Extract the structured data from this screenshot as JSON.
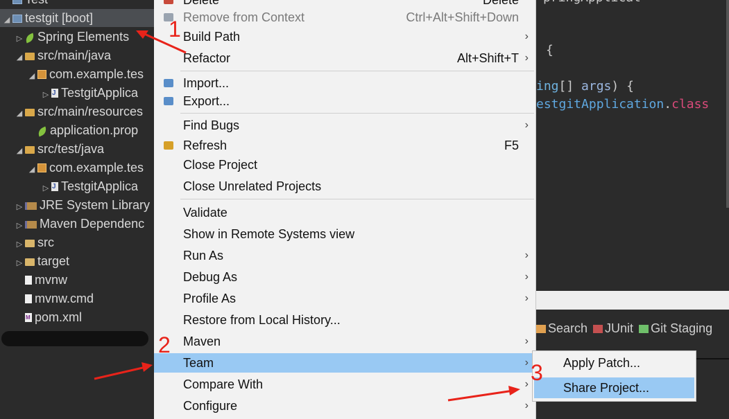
{
  "tree": {
    "items": [
      {
        "label": "Test",
        "icon": "project-icon",
        "twisty": "",
        "selected": false,
        "indent": 0
      },
      {
        "label": "testgit [boot]",
        "icon": "project-icon",
        "twisty": "◢",
        "selected": true,
        "indent": 0
      },
      {
        "label": "Spring Elements",
        "icon": "spring-leaf-icon",
        "twisty": "▷",
        "selected": false,
        "indent": 1
      },
      {
        "label": "src/main/java",
        "icon": "source-folder-icon",
        "twisty": "◢",
        "selected": false,
        "indent": 1
      },
      {
        "label": "com.example.tes",
        "icon": "package-icon",
        "twisty": "◢",
        "selected": false,
        "indent": 2
      },
      {
        "label": "TestgitApplica",
        "icon": "java-file-icon",
        "twisty": "▷",
        "selected": false,
        "indent": 3
      },
      {
        "label": "src/main/resources",
        "icon": "source-folder-icon",
        "twisty": "◢",
        "selected": false,
        "indent": 1
      },
      {
        "label": "application.prop",
        "icon": "spring-leaf-icon",
        "twisty": "",
        "selected": false,
        "indent": 2
      },
      {
        "label": "src/test/java",
        "icon": "source-folder-icon",
        "twisty": "◢",
        "selected": false,
        "indent": 1
      },
      {
        "label": "com.example.tes",
        "icon": "package-icon",
        "twisty": "◢",
        "selected": false,
        "indent": 2
      },
      {
        "label": "TestgitApplica",
        "icon": "java-file-icon",
        "twisty": "▷",
        "selected": false,
        "indent": 3
      },
      {
        "label": "JRE System Library",
        "icon": "library-icon",
        "twisty": "▷",
        "selected": false,
        "indent": 1
      },
      {
        "label": "Maven Dependenc",
        "icon": "library-icon",
        "twisty": "▷",
        "selected": false,
        "indent": 1
      },
      {
        "label": "src",
        "icon": "folder-icon",
        "twisty": "▷",
        "selected": false,
        "indent": 1
      },
      {
        "label": "target",
        "icon": "folder-icon",
        "twisty": "▷",
        "selected": false,
        "indent": 1
      },
      {
        "label": "mvnw",
        "icon": "file-icon",
        "twisty": "",
        "selected": false,
        "indent": 1
      },
      {
        "label": "mvnw.cmd",
        "icon": "file-icon",
        "twisty": "",
        "selected": false,
        "indent": 1
      },
      {
        "label": "pom.xml",
        "icon": "maven-file-icon",
        "twisty": "",
        "selected": false,
        "indent": 1
      }
    ]
  },
  "menu": {
    "items": [
      {
        "label": "Delete",
        "shortcut": "Delete",
        "submenu": false,
        "disabled": false,
        "icon": "delete-icon"
      },
      {
        "label": "Remove from Context",
        "shortcut": "Ctrl+Alt+Shift+Down",
        "submenu": false,
        "disabled": true,
        "icon": "remove-context-icon"
      },
      {
        "label": "Build Path",
        "shortcut": "",
        "submenu": true,
        "disabled": false,
        "icon": ""
      },
      {
        "label": "Refactor",
        "shortcut": "Alt+Shift+T",
        "submenu": true,
        "disabled": false,
        "icon": ""
      },
      {
        "label": "Import...",
        "shortcut": "",
        "submenu": false,
        "disabled": false,
        "icon": "import-icon"
      },
      {
        "label": "Export...",
        "shortcut": "",
        "submenu": false,
        "disabled": false,
        "icon": "export-icon"
      },
      {
        "label": "Find Bugs",
        "shortcut": "",
        "submenu": true,
        "disabled": false,
        "icon": ""
      },
      {
        "label": "Refresh",
        "shortcut": "F5",
        "submenu": false,
        "disabled": false,
        "icon": "refresh-icon"
      },
      {
        "label": "Close Project",
        "shortcut": "",
        "submenu": false,
        "disabled": false,
        "icon": ""
      },
      {
        "label": "Close Unrelated Projects",
        "shortcut": "",
        "submenu": false,
        "disabled": false,
        "icon": ""
      },
      {
        "label": "Validate",
        "shortcut": "",
        "submenu": false,
        "disabled": false,
        "icon": ""
      },
      {
        "label": "Show in Remote Systems view",
        "shortcut": "",
        "submenu": false,
        "disabled": false,
        "icon": ""
      },
      {
        "label": "Run As",
        "shortcut": "",
        "submenu": true,
        "disabled": false,
        "icon": ""
      },
      {
        "label": "Debug As",
        "shortcut": "",
        "submenu": true,
        "disabled": false,
        "icon": ""
      },
      {
        "label": "Profile As",
        "shortcut": "",
        "submenu": true,
        "disabled": false,
        "icon": ""
      },
      {
        "label": "Restore from Local History...",
        "shortcut": "",
        "submenu": false,
        "disabled": false,
        "icon": ""
      },
      {
        "label": "Maven",
        "shortcut": "",
        "submenu": true,
        "disabled": false,
        "icon": ""
      },
      {
        "label": "Team",
        "shortcut": "",
        "submenu": true,
        "disabled": false,
        "icon": "",
        "active": true
      },
      {
        "label": "Compare With",
        "shortcut": "",
        "submenu": true,
        "disabled": false,
        "icon": ""
      },
      {
        "label": "Configure",
        "shortcut": "",
        "submenu": true,
        "disabled": false,
        "icon": ""
      }
    ],
    "submenu_arrow": "›"
  },
  "submenu": {
    "items": [
      {
        "label": "Apply Patch...",
        "active": false
      },
      {
        "label": "Share Project...",
        "active": true
      }
    ]
  },
  "editor": {
    "lines": [
      "pringApplicat",
      "{",
      "ing[] args) {",
      "estgitApplication.class"
    ]
  },
  "views": {
    "tabs": [
      {
        "label": "Search",
        "icon": "search-icon"
      },
      {
        "label": "JUnit",
        "icon": "junit-icon"
      },
      {
        "label": "Git Staging",
        "icon": "git-staging-icon"
      }
    ]
  },
  "annotations": {
    "step1": "1",
    "step2": "2",
    "step3": "3",
    "arrow_color": "#e8231a"
  },
  "colors": {
    "menu_highlight": "#99c9f3",
    "dark_bg": "#2b2b2b"
  }
}
